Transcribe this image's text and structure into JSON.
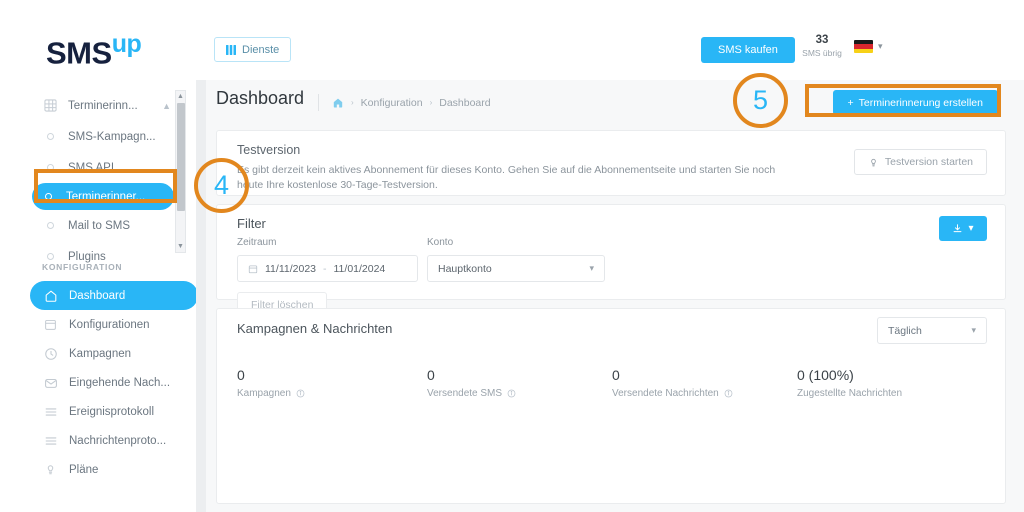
{
  "brand": {
    "name_main": "SMS",
    "name_sup": "up",
    "accent": "#29b6f6",
    "navy": "#16213e",
    "annotation": "#e2871e"
  },
  "topbar": {
    "services_button": "Dienste",
    "services_icon": "grid-icon",
    "buy_sms_button": "SMS kaufen",
    "sms_left_count": "33",
    "sms_left_caption": "SMS übrig",
    "language": "de",
    "language_chevron": "chevron-down-icon"
  },
  "sidebar": {
    "services": [
      {
        "label": "Terminerinn...",
        "icon": "grid-icon",
        "active": false,
        "group": true,
        "chevron": "chevron-up-icon"
      },
      {
        "label": "SMS-Kampagn...",
        "icon": "radio-icon",
        "active": false
      },
      {
        "label": "SMS API",
        "icon": "radio-icon",
        "active": false
      },
      {
        "label": "Terminerinner...",
        "icon": "radio-icon",
        "active": true
      },
      {
        "label": "Mail to SMS",
        "icon": "radio-icon",
        "active": false
      },
      {
        "label": "Plugins",
        "icon": "radio-icon",
        "active": false
      }
    ],
    "config_title": "KONFIGURATION",
    "config_items": [
      {
        "label": "Dashboard",
        "icon": "home-icon",
        "active": true
      },
      {
        "label": "Konfigurationen",
        "icon": "calendar-icon",
        "active": false
      },
      {
        "label": "Kampagnen",
        "icon": "clock-icon",
        "active": false
      },
      {
        "label": "Eingehende Nach...",
        "icon": "envelope-icon",
        "active": false
      },
      {
        "label": "Ereignisprotokoll",
        "icon": "list-icon",
        "active": false
      },
      {
        "label": "Nachrichtenproto...",
        "icon": "list-icon",
        "active": false
      },
      {
        "label": "Pläne",
        "icon": "bulb-icon",
        "active": false
      }
    ]
  },
  "page": {
    "title": "Dashboard",
    "breadcrumb_home_icon": "home-icon",
    "breadcrumb": [
      "Konfiguration",
      "Dashboard"
    ],
    "breadcrumb_separator": "›",
    "create_button": "Terminerinnerung erstellen",
    "create_button_icon": "plus-icon"
  },
  "trial_card": {
    "title": "Testversion",
    "description": "Es gibt derzeit kein aktives Abonnement für dieses Konto. Gehen Sie auf die Abonnementseite und starten Sie noch heute Ihre kostenlose 30-Tage-Testversion.",
    "button": "Testversion starten",
    "button_icon": "bulb-icon"
  },
  "filter_card": {
    "title": "Filter",
    "period_label": "Zeitraum",
    "date_from": "11/11/2023",
    "date_separator": "-",
    "date_to": "11/01/2024",
    "date_icon": "calendar-icon",
    "account_label": "Konto",
    "account_value": "Hauptkonto",
    "account_chevron": "chevron-down-icon",
    "clear_button": "Filter löschen",
    "download_icon": "download-icon",
    "download_chevron": "chevron-down-icon"
  },
  "stats_card": {
    "title": "Kampagnen & Nachrichten",
    "period_value": "Täglich",
    "period_chevron": "chevron-down-icon",
    "items": [
      {
        "value": "0",
        "label": "Kampagnen",
        "info_icon": "info-icon",
        "has_info": true
      },
      {
        "value": "0",
        "label": "Versendete SMS",
        "info_icon": "info-icon",
        "has_info": true
      },
      {
        "value": "0",
        "label": "Versendete Nachrichten",
        "info_icon": "info-icon",
        "has_info": true
      },
      {
        "value": "0 (100%)",
        "label": "Zugestellte Nachrichten",
        "info_icon": "",
        "has_info": false
      }
    ]
  },
  "annotations": {
    "step4": "4",
    "step5": "5"
  }
}
